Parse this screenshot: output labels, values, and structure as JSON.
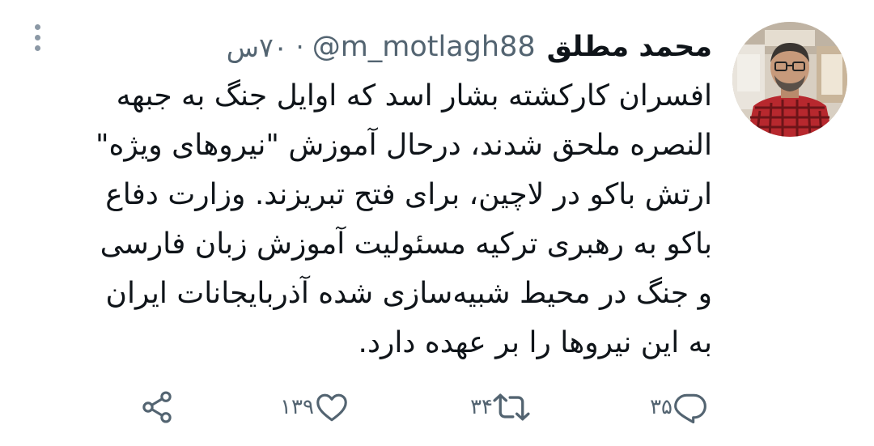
{
  "author": {
    "name": "محمد مطلق",
    "handle": "@m_motlagh88",
    "separator": "·",
    "time": "۷۰س"
  },
  "tweet": {
    "lines": [
      "افسران کارکشته بشار اسد که اوایل جنگ به جبهه",
      "النصره ملحق شدند، درحال آموزش \"نیروهای ویژه\"",
      "ارتش باکو در لاچین، برای فتح تبریزند. وزارت دفاع",
      "باکو به رهبری ترکیه مسئولیت آموزش زبان فارسی",
      "و جنگ در محیط شبیه‌سازی شده آذربایجانات ایران",
      "به این نیروها را بر عهده دارد."
    ]
  },
  "actions": {
    "reply": {
      "count": "۳۵",
      "icon": "reply-icon"
    },
    "retweet": {
      "count": "۳۴",
      "icon": "retweet-icon"
    },
    "like": {
      "count": "۱۳۹",
      "icon": "heart-icon"
    },
    "share": {
      "icon": "share-icon"
    }
  },
  "colors": {
    "text": "#0f1419",
    "secondary": "#536471"
  }
}
